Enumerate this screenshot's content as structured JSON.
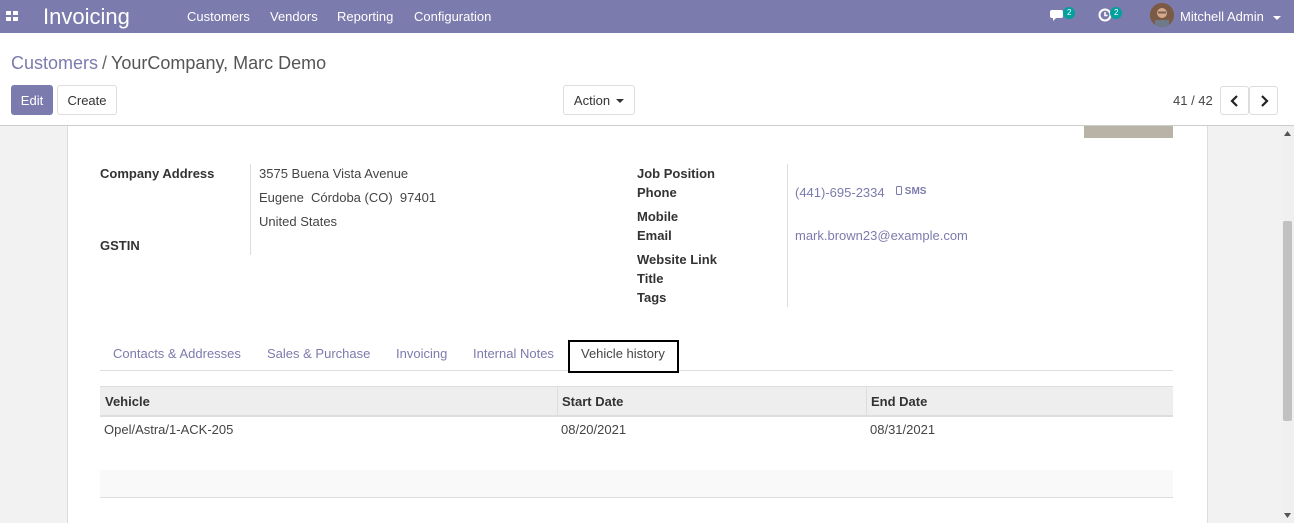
{
  "navbar": {
    "app_title": "Invoicing",
    "menu": [
      "Customers",
      "Vendors",
      "Reporting",
      "Configuration"
    ],
    "messages_count": "2",
    "activities_count": "2",
    "user_name": "Mitchell Admin"
  },
  "breadcrumb": {
    "parent": "Customers",
    "separator": "/",
    "current": "YourCompany, Marc Demo"
  },
  "toolbar": {
    "edit_label": "Edit",
    "create_label": "Create",
    "action_label": "Action",
    "pager": "41 / 42"
  },
  "form": {
    "company_address_label": "Company Address",
    "address_line1": "3575 Buena Vista Avenue",
    "address_line2": "Eugene  Córdoba (CO)  97401",
    "address_line3": "United States",
    "gstin_label": "GSTIN",
    "job_position_label": "Job Position",
    "phone_label": "Phone",
    "phone_value": "(441)-695-2334",
    "sms_label": "SMS",
    "mobile_label": "Mobile",
    "email_label": "Email",
    "email_value": "mark.brown23@example.com",
    "website_label": "Website Link",
    "title_label": "Title",
    "tags_label": "Tags"
  },
  "tabs": [
    "Contacts & Addresses",
    "Sales & Purchase",
    "Invoicing",
    "Internal Notes",
    "Vehicle history"
  ],
  "vehicle_table": {
    "headers": [
      "Vehicle",
      "Start Date",
      "End Date"
    ],
    "rows": [
      [
        "Opel/Astra/1-ACK-205",
        "08/20/2021",
        "08/31/2021"
      ]
    ]
  },
  "colors": {
    "brand": "#7c7bad",
    "badge": "#00a09d"
  }
}
